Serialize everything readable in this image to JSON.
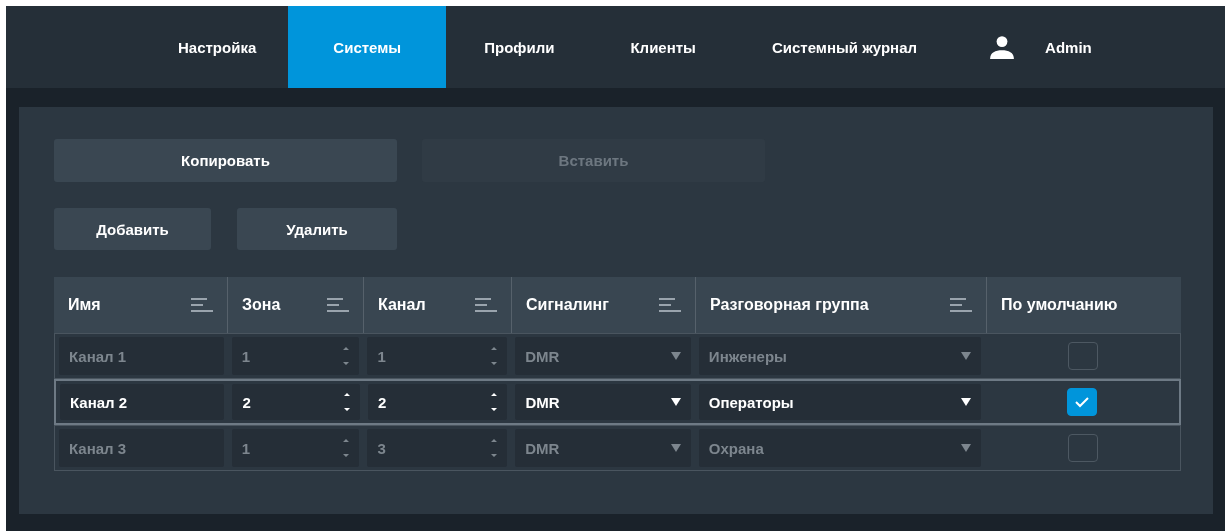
{
  "nav": {
    "tabs": [
      {
        "label": "Настройка",
        "selected": false
      },
      {
        "label": "Системы",
        "selected": true
      },
      {
        "label": "Профили",
        "selected": false
      },
      {
        "label": "Клиенты",
        "selected": false
      },
      {
        "label": "Системный журнал",
        "selected": false
      }
    ],
    "user": "Admin"
  },
  "clipboard_buttons": [
    {
      "label": "Копировать",
      "disabled": false
    },
    {
      "label": "Вставить",
      "disabled": true
    }
  ],
  "edit_buttons": [
    {
      "label": "Добавить",
      "disabled": false
    },
    {
      "label": "Удалить",
      "disabled": false
    }
  ],
  "table": {
    "columns": [
      {
        "label": "Имя",
        "filter": true
      },
      {
        "label": "Зона",
        "filter": true
      },
      {
        "label": "Канал",
        "filter": true
      },
      {
        "label": "Сигналинг",
        "filter": true
      },
      {
        "label": "Разговорная группа",
        "filter": true
      },
      {
        "label": "По умолчанию",
        "filter": false
      }
    ],
    "rows": [
      {
        "name": "Канал 1",
        "zone": "1",
        "channel": "1",
        "signaling": "DMR",
        "talk_group": "Инженеры",
        "default": false,
        "selected": false
      },
      {
        "name": "Канал 2",
        "zone": "2",
        "channel": "2",
        "signaling": "DMR",
        "talk_group": "Операторы",
        "default": true,
        "selected": true
      },
      {
        "name": "Канал 3",
        "zone": "1",
        "channel": "3",
        "signaling": "DMR",
        "talk_group": "Охрана",
        "default": false,
        "selected": false
      }
    ]
  }
}
